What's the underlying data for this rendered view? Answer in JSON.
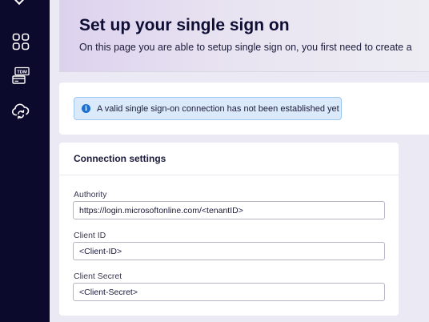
{
  "sidebar": {
    "items": [
      {
        "icon": "grid-icon"
      },
      {
        "icon": "tdm-card-icon",
        "badge": "TDM"
      },
      {
        "icon": "cloud-sync-icon"
      }
    ]
  },
  "header": {
    "title": "Set up your single sign on",
    "description": "On this page you are able to setup single sign on, you first need to create a"
  },
  "alert": {
    "icon": "info-icon",
    "glyph": "i",
    "text": "A valid single sign-on connection has not been established yet"
  },
  "connection": {
    "title": "Connection settings",
    "authority": {
      "label": "Authority",
      "value": "https://login.microsoftonline.com/<tenantID>"
    },
    "client_id": {
      "label": "Client ID",
      "value": "<Client-ID>"
    },
    "client_secret": {
      "label": "Client Secret",
      "value": "<Client-Secret>"
    }
  },
  "colors": {
    "sidebar": "#0b0a2c",
    "alert_bg": "#dbeafa",
    "alert_border": "#9fc6ee",
    "info_icon": "#1d6fd1"
  }
}
